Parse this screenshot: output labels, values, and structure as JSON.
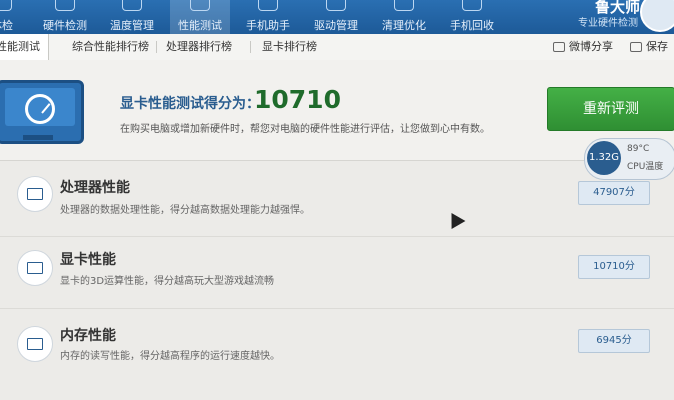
{
  "top_nav": {
    "items": [
      {
        "label": "体检"
      },
      {
        "label": "硬件检测"
      },
      {
        "label": "温度管理"
      },
      {
        "label": "性能测试"
      },
      {
        "label": "手机助手"
      },
      {
        "label": "驱动管理"
      },
      {
        "label": "清理优化"
      },
      {
        "label": "手机回收"
      }
    ],
    "brand": "鲁大师",
    "brand_sub": "专业硬件检测"
  },
  "sub_tabs": {
    "items": [
      {
        "label": "性能测试"
      },
      {
        "label": "综合性能排行榜"
      },
      {
        "label": "处理器排行榜"
      },
      {
        "label": "显卡排行榜"
      }
    ],
    "share_label": "微博分享",
    "save_label": "保存"
  },
  "hero": {
    "score_label": "显卡性能测试得分为：",
    "score_value": "10710",
    "description": "在购买电脑或增加新硬件时，帮您对电脑的硬件性能进行评估，让您做到心中有数。",
    "retest_label": "重新评测",
    "temp": {
      "value": "1.32G",
      "temp": "89°C",
      "label": "CPU温度"
    }
  },
  "rows": [
    {
      "title": "处理器性能",
      "desc": "处理器的数据处理性能，得分越高数据处理能力越强悍。",
      "score": "47907分"
    },
    {
      "title": "显卡性能",
      "desc": "显卡的3D运算性能，得分越高玩大型游戏越流畅",
      "score": "10710分"
    },
    {
      "title": "内存性能",
      "desc": "内存的读写性能，得分越高程序的运行速度越快。",
      "score": "6945分"
    }
  ]
}
